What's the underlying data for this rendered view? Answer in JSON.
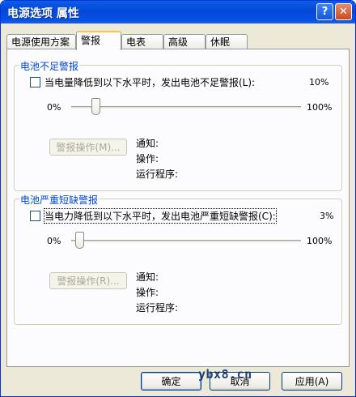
{
  "window": {
    "title": "电源选项 属性",
    "help_label": "?",
    "close_label": "✕"
  },
  "tabs": [
    {
      "label": "电源使用方案",
      "active": false
    },
    {
      "label": "警报",
      "active": true
    },
    {
      "label": "电表",
      "active": false
    },
    {
      "label": "高级",
      "active": false
    },
    {
      "label": "休眠",
      "active": false
    }
  ],
  "low_battery": {
    "title": "电池不足警报",
    "checkbox_label": "当电量降低到以下水平时，发出电池不足警报(L):",
    "checked": false,
    "current_value": "10%",
    "slider_min": "0%",
    "slider_max": "100%",
    "slider_level_percent": 10,
    "action_button": "警报操作(M)...",
    "notify_label": "通知:",
    "action_label": "操作:",
    "run_label": "运行程序:"
  },
  "critical_battery": {
    "title": "电池严重短缺警报",
    "checkbox_label": "当电力降低到以下水平时，发出电池严重短缺警报(C):",
    "checked": false,
    "current_value": "3%",
    "slider_min": "0%",
    "slider_max": "100%",
    "slider_level_percent": 3,
    "action_button": "警报操作(R)...",
    "notify_label": "通知:",
    "action_label": "操作:",
    "run_label": "运行程序:"
  },
  "footer": {
    "ok_label": "确定",
    "cancel_label": "取消",
    "apply_label": "应用(A)",
    "watermark": "ybx8.cn"
  }
}
